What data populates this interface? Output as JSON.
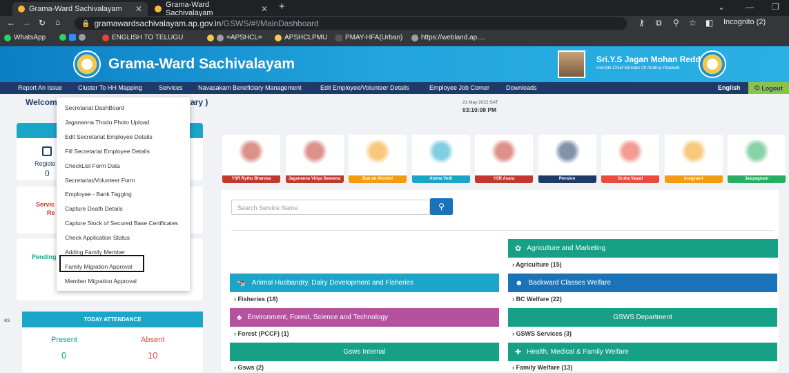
{
  "browser": {
    "tabs": [
      {
        "title": "Grama-Ward Sachivalayam"
      },
      {
        "title": "Grama-Ward Sachivalayam"
      }
    ],
    "url_host": "gramawardsachivalayam.ap.gov.in",
    "url_path": "/GSWS/#!/MainDashboard",
    "profile_label": "Incognito (2)",
    "bookmarks": [
      "WhatsApp",
      "ENGLISH TO TELUGU",
      "=APSHCL=",
      "APSHCLPMU",
      "PMAY-HFA(Urban)",
      "https://webland.ap...."
    ]
  },
  "header": {
    "title": "Grama-Ward Sachivalayam",
    "leader_name": "Sri.Y.S Jagan Mohan Reddy",
    "leader_title": "Hon'ble Chief Minister Of Andhra Pradesh"
  },
  "nav": {
    "items": [
      "Report An Issue",
      "Cluster To HH Mapping",
      "Services",
      "Navasakam Beneficiary Management",
      "Edit Employee/Volunteer Details",
      "Employee Job Corner",
      "Downloads"
    ],
    "language": "English",
    "logout": "Logout"
  },
  "welcome": {
    "text": "Welcom",
    "suffix": "tary )"
  },
  "datetime": {
    "date": "21 May 2022 SAT",
    "time": "03:10:08 PM"
  },
  "services_menu": [
    "Secretariat DashBoard",
    "Jagananna Thodu Photo Upload",
    "Edit Secretariat Employee Details",
    "Fill Secretariat Employee Details",
    "CheckList Form Data",
    "Secretariat/Volunteer Form",
    "Employee - Bank Tagging",
    "Capture Death Details",
    "Capture Stock of Secured Base Certificates",
    "Check Application Status",
    "Adding Family Member",
    "Family Migration Approval",
    "Member Migration Approval"
  ],
  "left_panel": {
    "registe": "Registe",
    "zero": "0",
    "servic": "Servic",
    "re": "Re",
    "pending": "Pending",
    "es": "es"
  },
  "attendance": {
    "title": "TODAY ATTENDANCE",
    "present_label": "Present",
    "absent_label": "Absent",
    "present": "0",
    "absent": "10"
  },
  "schemes": [
    {
      "name": "YSR Rythu Bharosa",
      "color": "#c0392b"
    },
    {
      "name": "Jagananna Vidya Deevena",
      "color": "#c0392b"
    },
    {
      "name": "Ban on Alcohol",
      "color": "#f39c12"
    },
    {
      "name": "Amma Vodi",
      "color": "#1ba5c9"
    },
    {
      "name": "YSR Asara",
      "color": "#c0392b"
    },
    {
      "name": "Pension",
      "color": "#1e3a67"
    },
    {
      "name": "Gruha Vasati",
      "color": "#e74c3c"
    },
    {
      "name": "Arogyasri",
      "color": "#f39c12"
    },
    {
      "name": "Jalayagnam",
      "color": "#27ae60"
    }
  ],
  "search": {
    "placeholder": "Search Service Name"
  },
  "departments": [
    {
      "name": "Agriculture and Marketing",
      "sub": "Agriculture (15)",
      "color": "#16a085"
    },
    {
      "name": "Animal Husbandry, Dairy Development and Fisheries",
      "sub": "Fisheries (18)",
      "color": "#1ba5c9"
    },
    {
      "name": "Backward Classes Welfare",
      "sub": "BC Welfare (22)",
      "color": "#1a73b8"
    },
    {
      "name": "Environment, Forest, Science and Technology",
      "sub": "Forest (PCCF) (1)",
      "color": "#b5529f"
    },
    {
      "name": "GSWS Department",
      "sub": "GSWS Services (3)",
      "color": "#16a085"
    },
    {
      "name": "Gsws Internal",
      "sub": "Gsws (2)",
      "color": "#16a085"
    },
    {
      "name": "Health, Medical & Family Welfare",
      "sub": "Family Welfare (13)",
      "color": "#16a085"
    }
  ],
  "colors": {
    "banner": "#0c7ec4",
    "nav": "#1e3a67",
    "accent_cyan": "#1ba5c9",
    "absent": "#e74c3c",
    "present": "#27ae60"
  }
}
